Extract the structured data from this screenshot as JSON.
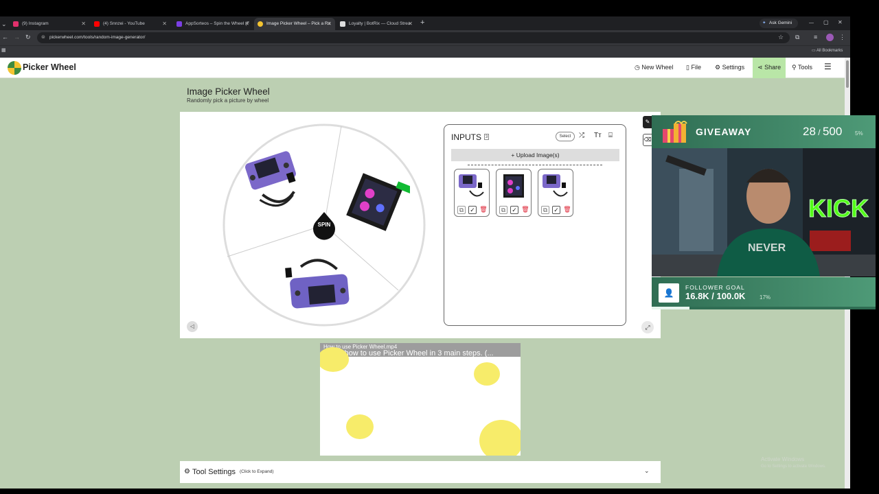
{
  "browser": {
    "tabs": [
      {
        "label": "(9) Instagram",
        "color": "#e1306c"
      },
      {
        "label": "(4) Snnzei - YouTube",
        "color": "#ff0000"
      },
      {
        "label": "AppSorteos – Spin the Wheel (F",
        "color": "#7b3fe4"
      },
      {
        "label": "Image Picker Wheel – Pick a Ra",
        "color": "#f4c430"
      },
      {
        "label": "Loyalty | BotRix — Cloud Strea",
        "color": "#dddddd"
      }
    ],
    "ask_gemini": "Ask Gemini",
    "url": "pickerwheel.com/tools/random-image-generator/",
    "all_bookmarks": "All Bookmarks"
  },
  "site": {
    "logo": "Picker Wheel",
    "nav": {
      "new_wheel": "New Wheel",
      "file": "File",
      "settings": "Settings",
      "share": "Share",
      "tools": "Tools"
    },
    "page_title": "Image Picker Wheel",
    "page_subtitle": "Randomly pick a picture by wheel",
    "spin_label": "SPIN",
    "inputs": {
      "title": "INPUTS",
      "count": "3",
      "select_label": "Select",
      "upload_label": "Upload Image(s)"
    },
    "video": {
      "filename": "How to use Picker Wheel.mp4",
      "title": "Show how to use Picker Wheel in 3 main steps. (..."
    },
    "tool_settings": {
      "label": "Tool Settings",
      "hint": "(Click to Expand)"
    }
  },
  "overlay": {
    "giveaway_label": "GIVEAWAY",
    "giveaway_count": "28",
    "giveaway_total": "500",
    "giveaway_percent": "5%",
    "follower_label": "FOLLOWER GOAL",
    "follower_value": "16.8K / 100.0K",
    "follower_percent": "17%",
    "follower_progress": 0.17
  },
  "watermark": {
    "line1": "Activate Windows",
    "line2": "Go to Settings to activate Windows."
  },
  "colors": {
    "site_bg": "#bccfb2",
    "share_bg": "#b9e6a7",
    "overlay_green": "#3f8466",
    "kick_green": "#53fc18"
  }
}
